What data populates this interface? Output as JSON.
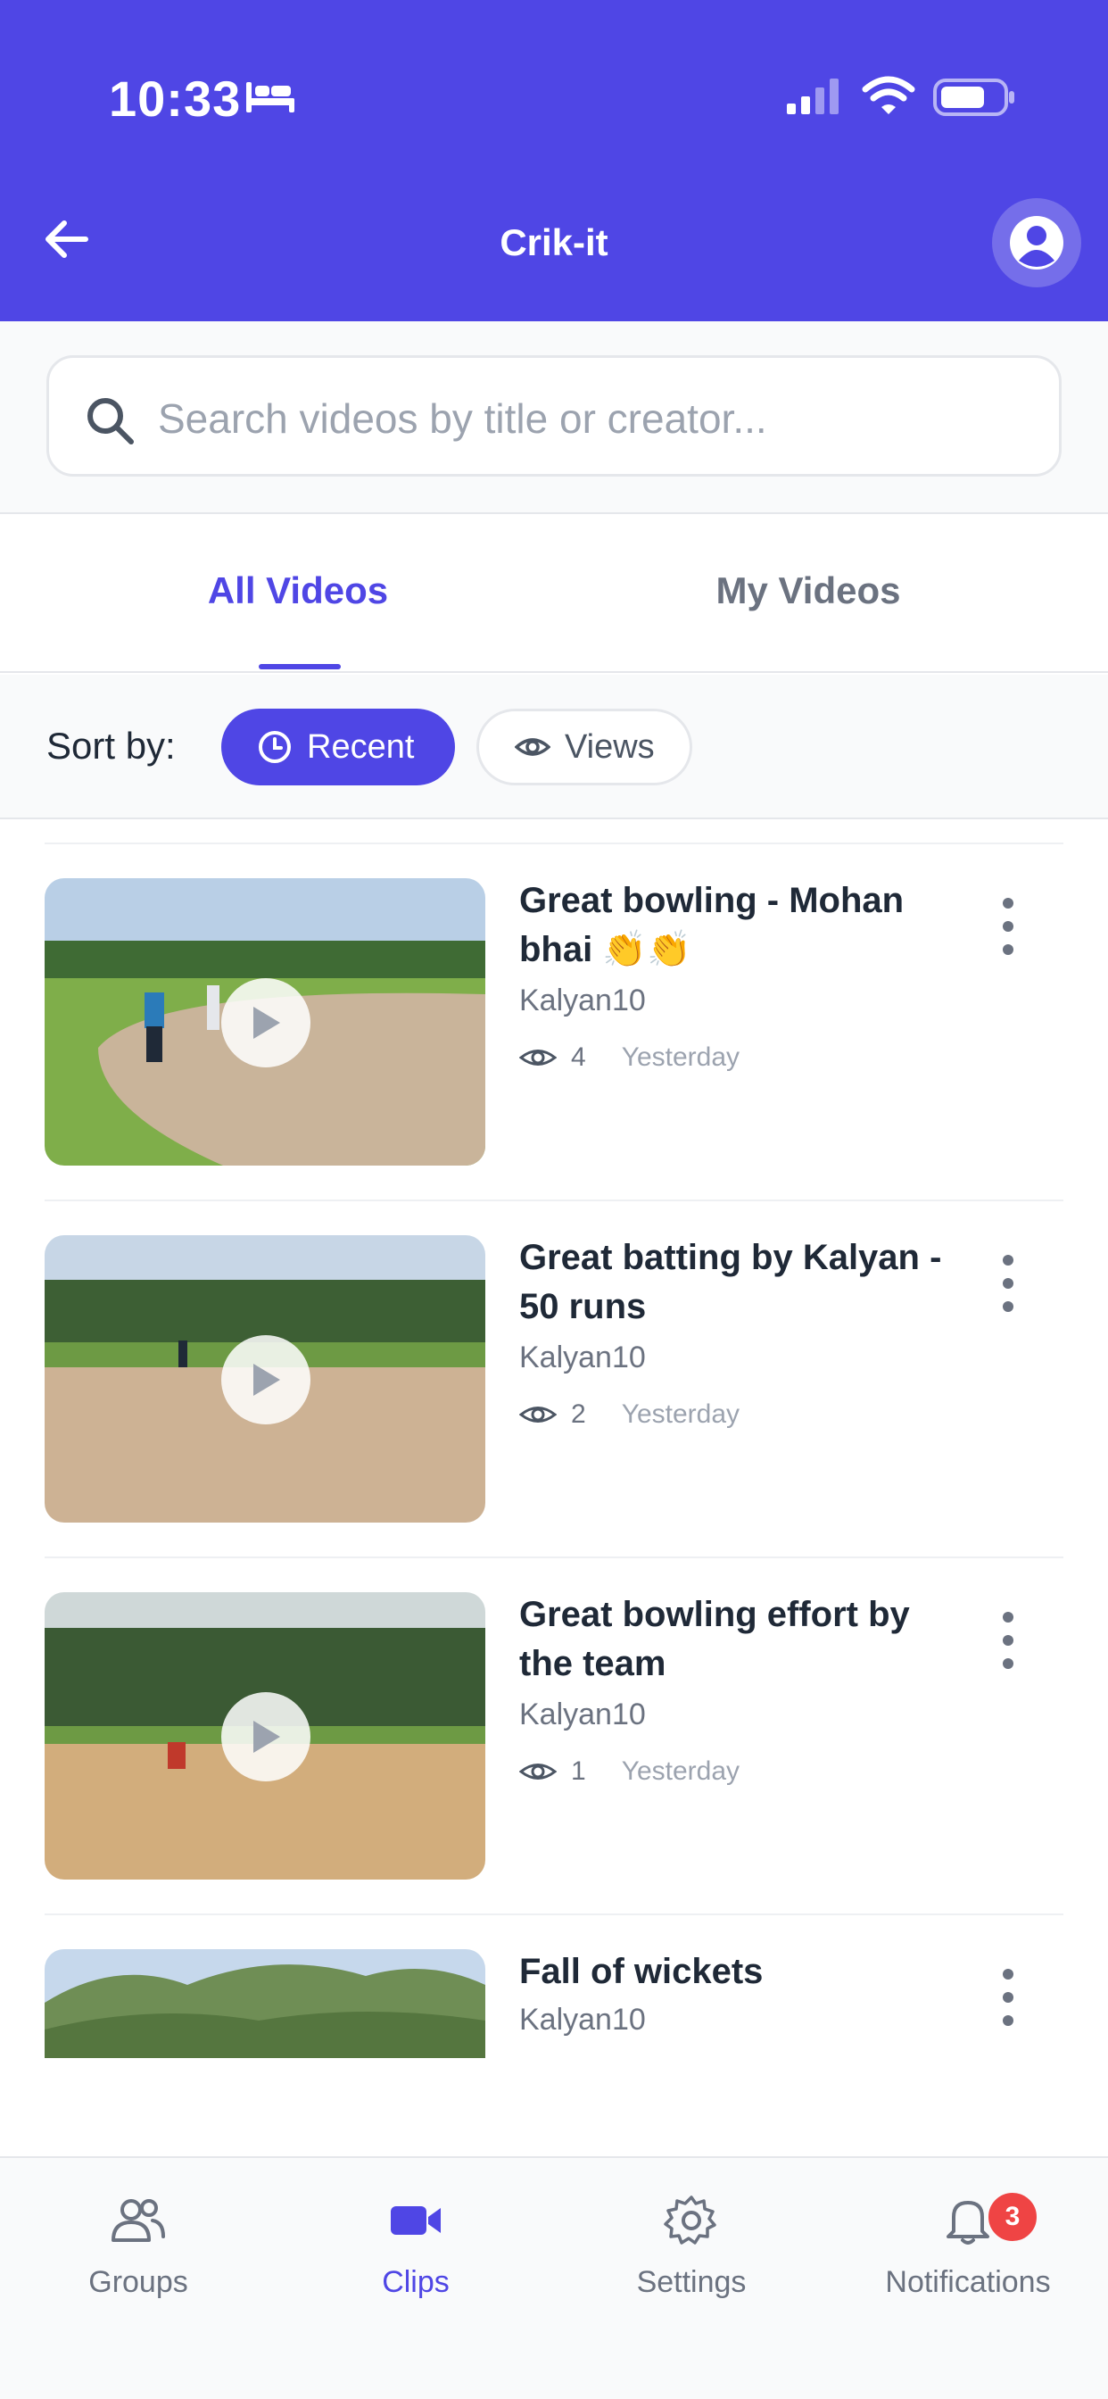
{
  "status_bar": {
    "time": "10:33"
  },
  "header": {
    "title": "Crik-it"
  },
  "search": {
    "placeholder": "Search videos by title or creator...",
    "value": ""
  },
  "tabs": [
    {
      "label": "All Videos",
      "active": true
    },
    {
      "label": "My Videos",
      "active": false
    }
  ],
  "sort": {
    "label": "Sort by:",
    "options": [
      {
        "label": "Recent",
        "active": true,
        "icon": "clock-icon"
      },
      {
        "label": "Views",
        "active": false,
        "icon": "eye-icon"
      }
    ]
  },
  "videos": [
    {
      "title": "Great bowling - Mohan bhai 👏👏",
      "creator": "Kalyan10",
      "views": "4",
      "date": "Yesterday"
    },
    {
      "title": "Great batting by Kalyan - 50 runs",
      "creator": "Kalyan10",
      "views": "2",
      "date": "Yesterday"
    },
    {
      "title": "Great bowling effort by the team",
      "creator": "Kalyan10",
      "views": "1",
      "date": "Yesterday"
    },
    {
      "title": "Fall of wickets",
      "creator": "Kalyan10",
      "views": "",
      "date": ""
    }
  ],
  "bottom_nav": [
    {
      "label": "Groups",
      "icon": "users-icon",
      "active": false
    },
    {
      "label": "Clips",
      "icon": "video-camera-icon",
      "active": true
    },
    {
      "label": "Settings",
      "icon": "gear-icon",
      "active": false
    },
    {
      "label": "Notifications",
      "icon": "bell-icon",
      "active": false,
      "badge": "3"
    }
  ],
  "colors": {
    "primary": "#4f46e5",
    "badge": "#ef4444",
    "muted": "#6b7280"
  }
}
